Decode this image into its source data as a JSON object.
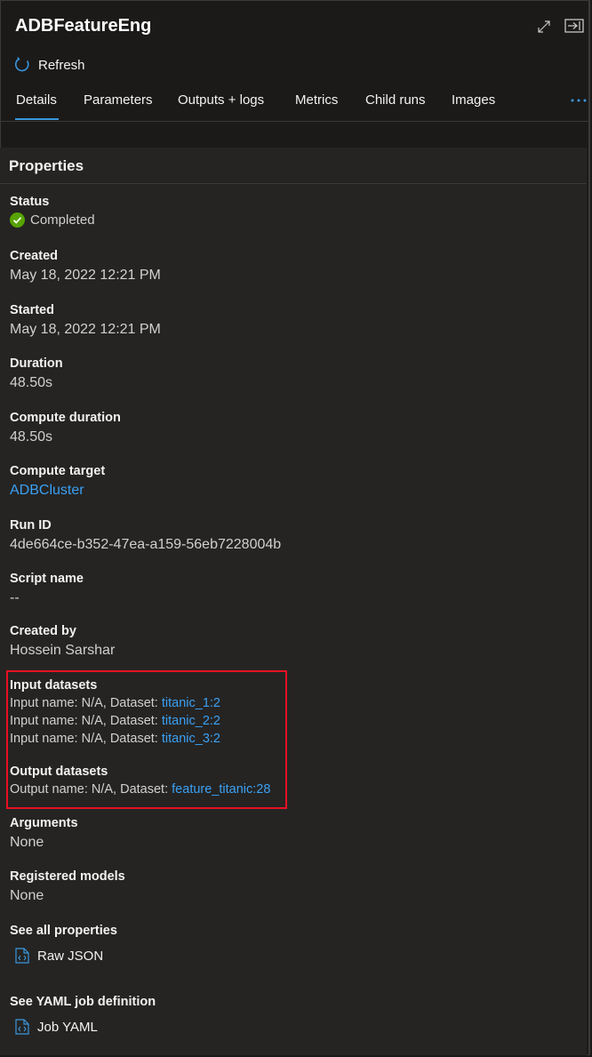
{
  "header": {
    "title": "ADBFeatureEng",
    "refresh_label": "Refresh"
  },
  "tabs": [
    {
      "label": "Details",
      "active": true
    },
    {
      "label": "Parameters"
    },
    {
      "label": "Outputs + logs"
    },
    {
      "label": "Metrics"
    },
    {
      "label": "Child runs"
    },
    {
      "label": "Images"
    }
  ],
  "properties": {
    "heading": "Properties",
    "status": {
      "label": "Status",
      "value": "Completed"
    },
    "created": {
      "label": "Created",
      "value": "May 18, 2022 12:21 PM"
    },
    "started": {
      "label": "Started",
      "value": "May 18, 2022 12:21 PM"
    },
    "duration": {
      "label": "Duration",
      "value": "48.50s"
    },
    "compute_duration": {
      "label": "Compute duration",
      "value": "48.50s"
    },
    "compute_target": {
      "label": "Compute target",
      "value": "ADBCluster"
    },
    "run_id": {
      "label": "Run ID",
      "value": "4de664ce-b352-47ea-a159-56eb7228004b"
    },
    "script_name": {
      "label": "Script name",
      "value": "--"
    },
    "created_by": {
      "label": "Created by",
      "value": "Hossein Sarshar"
    },
    "input_datasets": {
      "label": "Input datasets",
      "items": [
        {
          "prefix": "Input name: N/A, Dataset: ",
          "dataset": "titanic_1:2"
        },
        {
          "prefix": "Input name: N/A, Dataset: ",
          "dataset": "titanic_2:2"
        },
        {
          "prefix": "Input name: N/A, Dataset: ",
          "dataset": "titanic_3:2"
        }
      ]
    },
    "output_datasets": {
      "label": "Output datasets",
      "items": [
        {
          "prefix": "Output name: N/A, Dataset: ",
          "dataset": "feature_titanic:28"
        }
      ]
    },
    "arguments": {
      "label": "Arguments",
      "value": "None"
    },
    "registered_models": {
      "label": "Registered models",
      "value": "None"
    },
    "see_all": {
      "label": "See all properties",
      "link": "Raw JSON"
    },
    "see_yaml": {
      "label": "See YAML job definition",
      "link": "Job YAML"
    }
  },
  "colors": {
    "accent": "#3a96dd",
    "link": "#3aa0f3",
    "success": "#57a300",
    "highlight_border": "#e81123"
  },
  "icons": [
    "expand-icon",
    "dock-panel-icon",
    "refresh-icon",
    "more-icon",
    "check-circle-icon",
    "code-file-icon"
  ]
}
